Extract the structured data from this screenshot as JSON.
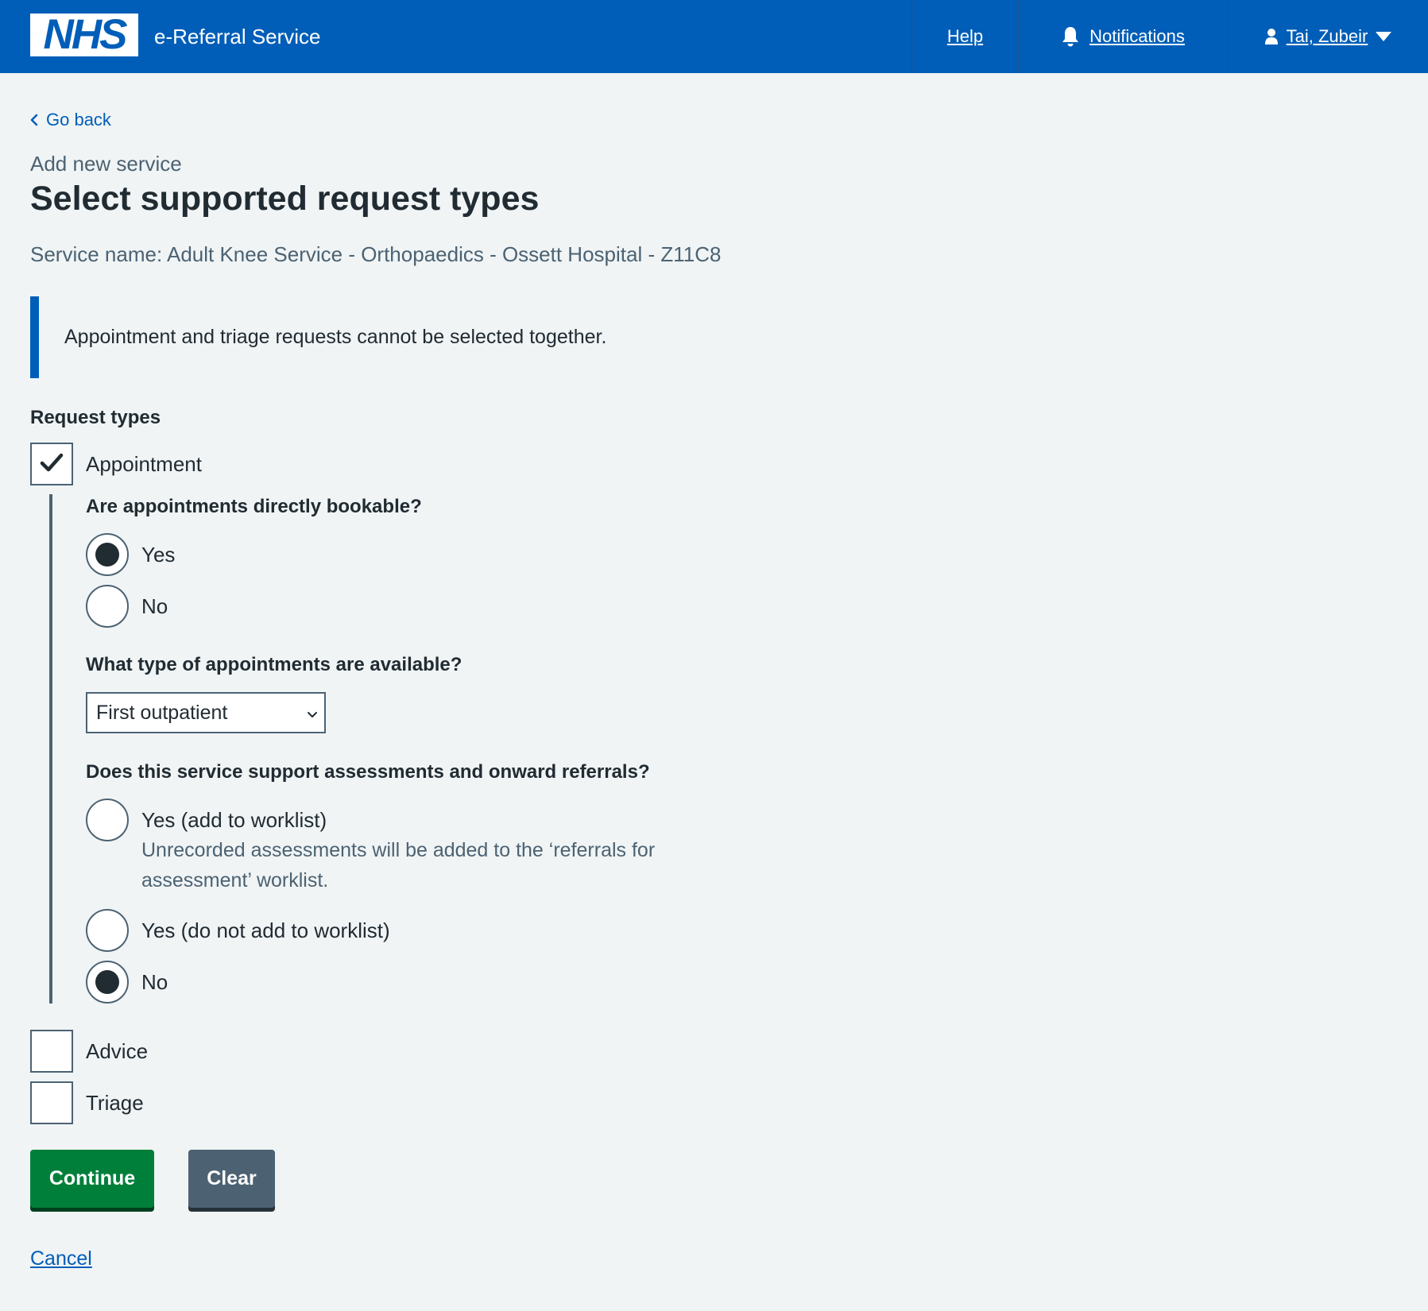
{
  "header": {
    "logo_text": "NHS",
    "service_name": "e-Referral Service",
    "nav": {
      "help": "Help",
      "notifications": "Notifications",
      "user": "Tai, Zubeir"
    }
  },
  "back_link": "Go back",
  "caption": "Add new service",
  "title": "Select supported request types",
  "service_line": "Service name: Adult Knee Service - Orthopaedics - Ossett Hospital - Z11C8",
  "inset_text": "Appointment and triage requests cannot be selected together.",
  "request_types": {
    "legend": "Request types",
    "appointment": {
      "label": "Appointment",
      "checked": true,
      "bookable": {
        "question": "Are appointments directly bookable?",
        "options": [
          {
            "label": "Yes",
            "selected": true
          },
          {
            "label": "No",
            "selected": false
          }
        ]
      },
      "appointment_type": {
        "question": "What type of appointments are available?",
        "selected": "First outpatient"
      },
      "assessments": {
        "question": "Does this service support assessments and onward referrals?",
        "options": [
          {
            "label": "Yes (add to worklist)",
            "hint": "Unrecorded assessments will be added to the ‘referrals for assessment’ worklist.",
            "selected": false
          },
          {
            "label": "Yes (do not add to worklist)",
            "selected": false
          },
          {
            "label": "No",
            "selected": true
          }
        ]
      }
    },
    "advice": {
      "label": "Advice",
      "checked": false
    },
    "triage": {
      "label": "Triage",
      "checked": false
    }
  },
  "buttons": {
    "continue": "Continue",
    "clear": "Clear"
  },
  "cancel": "Cancel",
  "colors": {
    "nhs_blue": "#005eb8",
    "background": "#f0f4f5",
    "text": "#212b32",
    "secondary_text": "#4c6272",
    "continue_green": "#007f3b",
    "clear_grey": "#4c6272"
  },
  "icons": {
    "back": "chevron-left-icon",
    "notifications": "bell-icon",
    "user": "person-icon",
    "user_menu": "caret-down-icon",
    "select": "chevron-down-icon",
    "checked": "checkmark-icon"
  }
}
